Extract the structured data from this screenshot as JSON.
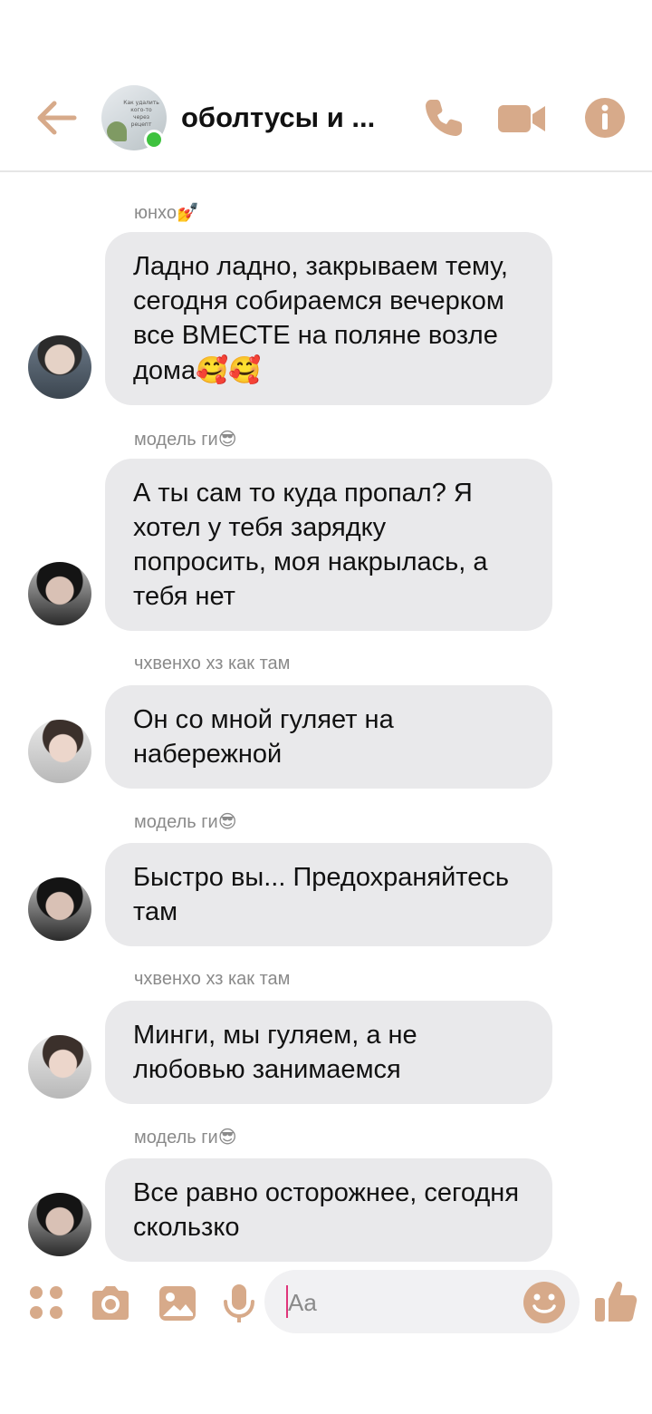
{
  "colors": {
    "accent": "#d7aa8a",
    "bubble": "#e9e9eb",
    "online": "#3ec23e",
    "caret": "#e0357a"
  },
  "header": {
    "title": "оболтусы и ...",
    "avatar_note": "Как удалить кого-то через рецепт",
    "icons": [
      "back-arrow-icon",
      "phone-icon",
      "video-camera-icon",
      "info-icon"
    ]
  },
  "messages": [
    {
      "sender": "юнхо",
      "sender_emoji": "💅",
      "text": "Ладно ладно, закрываем тему, сегодня собираемся вечерком все ВМЕСТЕ на поляне возле дома",
      "text_emoji": "🥰🥰"
    },
    {
      "sender": "модель ги",
      "sender_emoji": "😎",
      "text": "А ты сам то куда пропал? Я хотел у тебя зарядку попросить, моя накрылась, а тебя нет",
      "text_emoji": ""
    },
    {
      "sender": "чхвенхо хз как там",
      "sender_emoji": "",
      "text": "Он со мной гуляет на набережной",
      "text_emoji": ""
    },
    {
      "sender": "модель ги",
      "sender_emoji": "😎",
      "text": "Быстро вы... Предохраняйтесь там",
      "text_emoji": ""
    },
    {
      "sender": "чхвенхо хз как там",
      "sender_emoji": "",
      "text": "Минги, мы гуляем, а не любовью занимаемся",
      "text_emoji": ""
    },
    {
      "sender": "модель ги",
      "sender_emoji": "😎",
      "text": "Все равно осторожнее, сегодня скользко",
      "text_emoji": ""
    }
  ],
  "composer": {
    "placeholder": "Aa",
    "icons": [
      "apps-grid-icon",
      "camera-icon",
      "image-icon",
      "microphone-icon",
      "emoji-icon",
      "thumbs-up-icon"
    ]
  }
}
